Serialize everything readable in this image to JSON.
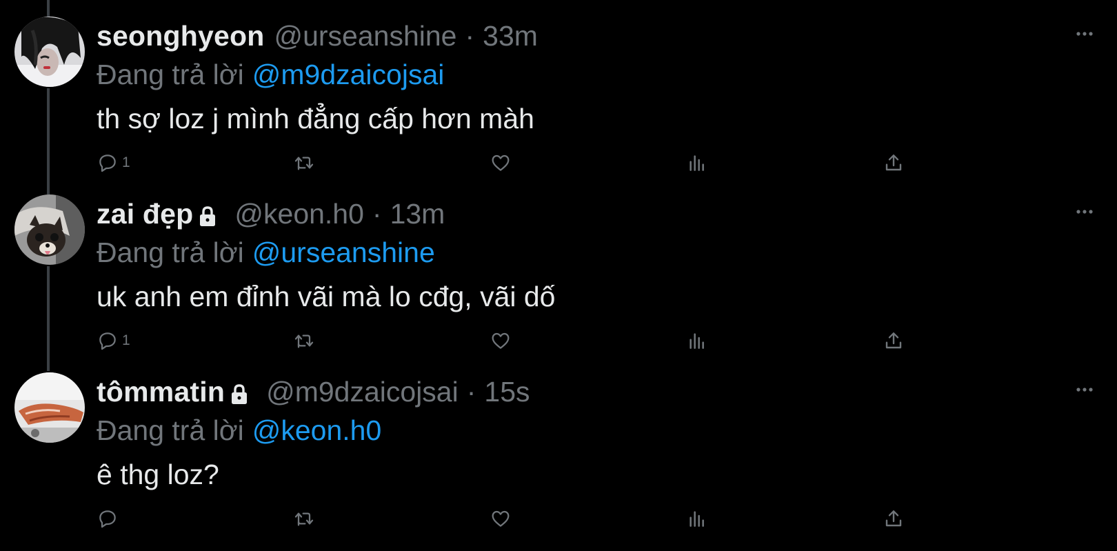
{
  "tweets": [
    {
      "display_name": "seonghyeon",
      "locked": false,
      "handle": "@urseanshine",
      "separator": "·",
      "time": "33m",
      "reply_prefix": "Đang trả lời",
      "reply_to": "@m9dzaicojsai",
      "text": "th sợ loz j mình đẳng cấp hơn màh",
      "reply_count": "1",
      "icons": [
        "reply-icon",
        "retweet-icon",
        "like-icon",
        "views-icon",
        "share-icon"
      ]
    },
    {
      "display_name": "zai đẹp",
      "locked": true,
      "handle": "@keon.h0",
      "separator": "·",
      "time": "13m",
      "reply_prefix": "Đang trả lời",
      "reply_to": "@urseanshine",
      "text": "uk anh em đỉnh vãi mà lo cđg, vãi dố",
      "reply_count": "1",
      "icons": [
        "reply-icon",
        "retweet-icon",
        "like-icon",
        "views-icon",
        "share-icon"
      ]
    },
    {
      "display_name": "tômmatin",
      "locked": true,
      "handle": "@m9dzaicojsai",
      "separator": "·",
      "time": "15s",
      "reply_prefix": "Đang trả lời",
      "reply_to": "@keon.h0",
      "text": "ê thg loz?",
      "reply_count": "",
      "icons": [
        "reply-icon",
        "retweet-icon",
        "like-icon",
        "views-icon",
        "share-icon"
      ]
    }
  ],
  "colors": {
    "background": "#000000",
    "primary_text": "#e7e9ea",
    "secondary_text": "#71767b",
    "link": "#1d9bf0",
    "thread_line": "#3a3f44"
  }
}
